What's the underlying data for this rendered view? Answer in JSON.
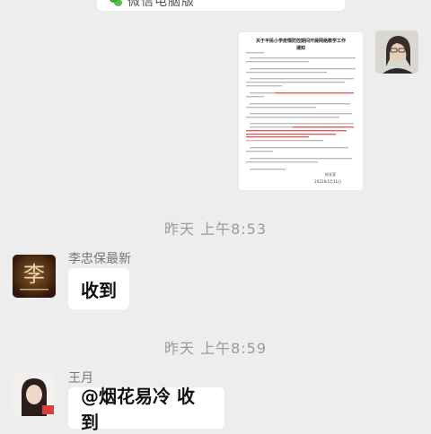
{
  "top_card": {
    "label": "微信电脑版",
    "icon": "wechat-logo-icon"
  },
  "document": {
    "title_line1": "关于平民小学疫情防控期间开展网络教学工作",
    "title_line2": "通知",
    "signature": "校长室",
    "date": "2022年1月11日",
    "icon": "document-image"
  },
  "messages": [
    {
      "timestamp": "昨天 上午8:53",
      "sender": "李忠保最新",
      "text": "收到"
    },
    {
      "timestamp": "昨天 上午8:59",
      "sender": "王月",
      "text": "@烟花易冷 收到"
    }
  ],
  "colors": {
    "background": "#ededed",
    "bubble": "#ffffff",
    "wechat_green": "#3cb034",
    "timestamp": "#9b9b9b"
  }
}
